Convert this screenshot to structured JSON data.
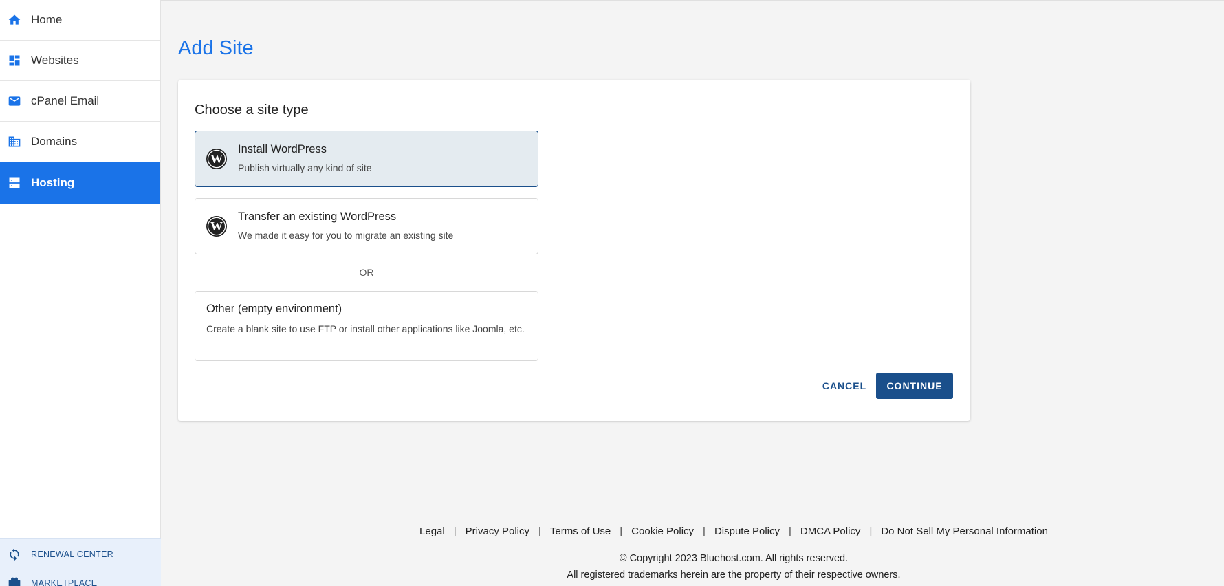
{
  "sidebar": {
    "items": [
      {
        "label": "Home",
        "icon": "home-icon"
      },
      {
        "label": "Websites",
        "icon": "dashboard-icon"
      },
      {
        "label": "cPanel Email",
        "icon": "mail-icon"
      },
      {
        "label": "Domains",
        "icon": "building-icon"
      },
      {
        "label": "Hosting",
        "icon": "server-icon",
        "active": true
      }
    ],
    "bottom": [
      {
        "label": "RENEWAL CENTER",
        "icon": "refresh-icon"
      },
      {
        "label": "MARKETPLACE",
        "icon": "gift-icon"
      }
    ]
  },
  "page": {
    "title": "Add Site"
  },
  "card": {
    "heading": "Choose a site type",
    "options": [
      {
        "title": "Install WordPress",
        "description": "Publish virtually any kind of site",
        "selected": true,
        "icon": "wordpress-icon"
      },
      {
        "title": "Transfer an existing WordPress",
        "description": "We made it easy for you to migrate an existing site",
        "selected": false,
        "icon": "wordpress-icon"
      },
      {
        "title": "Other (empty environment)",
        "description": "Create a blank site to use FTP or install other applications like Joomla, etc.",
        "selected": false
      }
    ],
    "or_label": "OR",
    "cancel_label": "CANCEL",
    "continue_label": "CONTINUE"
  },
  "footer": {
    "links": [
      "Legal",
      "Privacy Policy",
      "Terms of Use",
      "Cookie Policy",
      "Dispute Policy",
      "DMCA Policy",
      "Do Not Sell My Personal Information"
    ],
    "separator": "|",
    "copyright": "© Copyright 2023 Bluehost.com. All rights reserved.",
    "trademarks": "All registered trademarks herein are the property of their respective owners."
  },
  "colors": {
    "accent": "#1a73e8",
    "primary_button": "#1a4f8b",
    "selected_bg": "#e4ebf0",
    "page_bg": "#f4f4f4"
  }
}
